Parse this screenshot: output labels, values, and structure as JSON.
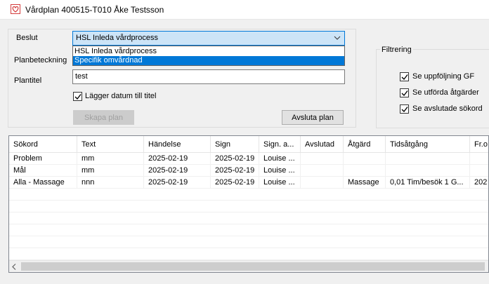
{
  "window": {
    "title": "Vårdplan 400515-T010 Åke Testsson"
  },
  "form": {
    "beslut_label": "Beslut",
    "beslut_value": "HSL Inleda vårdprocess",
    "beslut_options": [
      "HSL Inleda vårdprocess",
      "Specifik omvårdnad"
    ],
    "planbeteckning_label": "Planbeteckning",
    "plantitel_label": "Plantitel",
    "plantitel_value": "test",
    "datum_checkbox_label": "Lägger datum till titel",
    "skapa_button": "Skapa plan",
    "avsluta_button": "Avsluta plan"
  },
  "filter": {
    "title": "Filtrering",
    "options": [
      "Se uppföljning GF",
      "Se utförda åtgärder",
      "Se avslutade sökord"
    ]
  },
  "table": {
    "columns": [
      "Sökord",
      "Text",
      "Händelse",
      "Sign",
      "Sign. a...",
      "Avslutad",
      "Åtgärd",
      "Tidsåtgång",
      "Fr.o"
    ],
    "rows": [
      [
        "Problem",
        "mm",
        "2025-02-19",
        "2025-02-19",
        "Louise ...",
        "",
        "",
        "",
        ""
      ],
      [
        "Mål",
        "mm",
        "2025-02-19",
        "2025-02-19",
        "Louise ...",
        "",
        "",
        "",
        ""
      ],
      [
        "Alla - Massage",
        "nnn",
        "2025-02-19",
        "2025-02-19",
        "Louise ...",
        "",
        "Massage",
        "0,01 Tim/besök 1 G...",
        "202"
      ]
    ]
  }
}
